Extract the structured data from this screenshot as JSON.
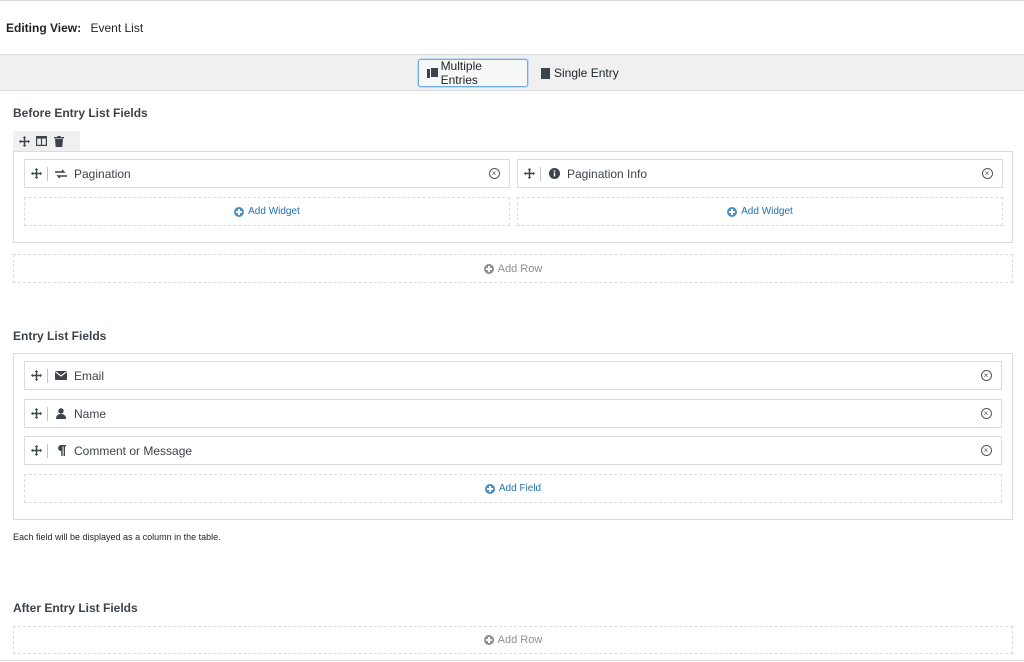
{
  "header": {
    "label": "Editing View:",
    "value": "Event List"
  },
  "tabs": [
    {
      "label": "Multiple Entries",
      "icon": "copy-icon",
      "active": true
    },
    {
      "label": "Single Entry",
      "icon": "document-icon",
      "active": false
    }
  ],
  "before": {
    "title": "Before Entry List Fields",
    "toolbar": [
      "move-icon",
      "columns-icon",
      "trash-icon"
    ],
    "widgets": [
      {
        "label": "Pagination",
        "icon": "arrows-exchange-icon"
      },
      {
        "label": "Pagination Info",
        "icon": "info-icon"
      }
    ],
    "add_widget": "Add Widget",
    "add_row": "Add Row"
  },
  "entry": {
    "title": "Entry List Fields",
    "fields": [
      {
        "label": "Email",
        "icon": "envelope-icon"
      },
      {
        "label": "Name",
        "icon": "user-icon"
      },
      {
        "label": "Comment or Message",
        "icon": "paragraph-icon"
      }
    ],
    "add_field": "Add Field",
    "hint": "Each field will be displayed as a column in the table."
  },
  "after": {
    "title": "After Entry List Fields",
    "add_row": "Add Row"
  }
}
